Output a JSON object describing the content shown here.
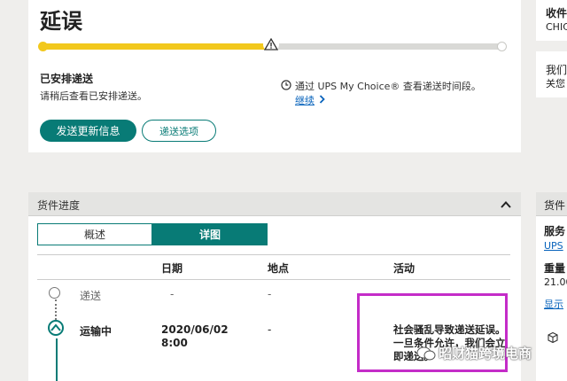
{
  "status": {
    "title": "延误",
    "progress_fraction": 0.5,
    "scheduled_title": "已安排递送",
    "scheduled_sub": "请稍后查看已安排递送。",
    "myChoice_text": "通过 UPS My Choice® 查看递送时间段。",
    "continue_link": "继续",
    "send_updates_button": "发送更新信息",
    "delivery_options_button": "递送选项"
  },
  "recipient": {
    "label": "收件",
    "city": "CHIC"
  },
  "contact": {
    "line1": "我们",
    "line2": "关您"
  },
  "progress": {
    "panel_title": "货件进度",
    "tabs": [
      "概述",
      "详图"
    ],
    "active_tab": 1,
    "columns": {
      "date": "日期",
      "location": "地点",
      "activity": "活动"
    },
    "rows": [
      {
        "status": "递送",
        "date": "-",
        "location": "-",
        "activity": "-"
      },
      {
        "status": "运输中",
        "date": "2020/06/02\n8:00",
        "location": "-",
        "activity": "社会骚乱导致递送延误。一旦条件允许，我们会立即递送。"
      }
    ]
  },
  "shipment": {
    "head": "货件",
    "service_label": "服务",
    "service_value": "UPS",
    "weight_label": "重量",
    "weight_value": "21.00",
    "show_link": "显示"
  },
  "watermark": "昭财猫跨境电商",
  "colors": {
    "accent": "#087b76",
    "progress": "#f2c81c",
    "highlight": "#c42cc8",
    "link": "#0662bb"
  }
}
